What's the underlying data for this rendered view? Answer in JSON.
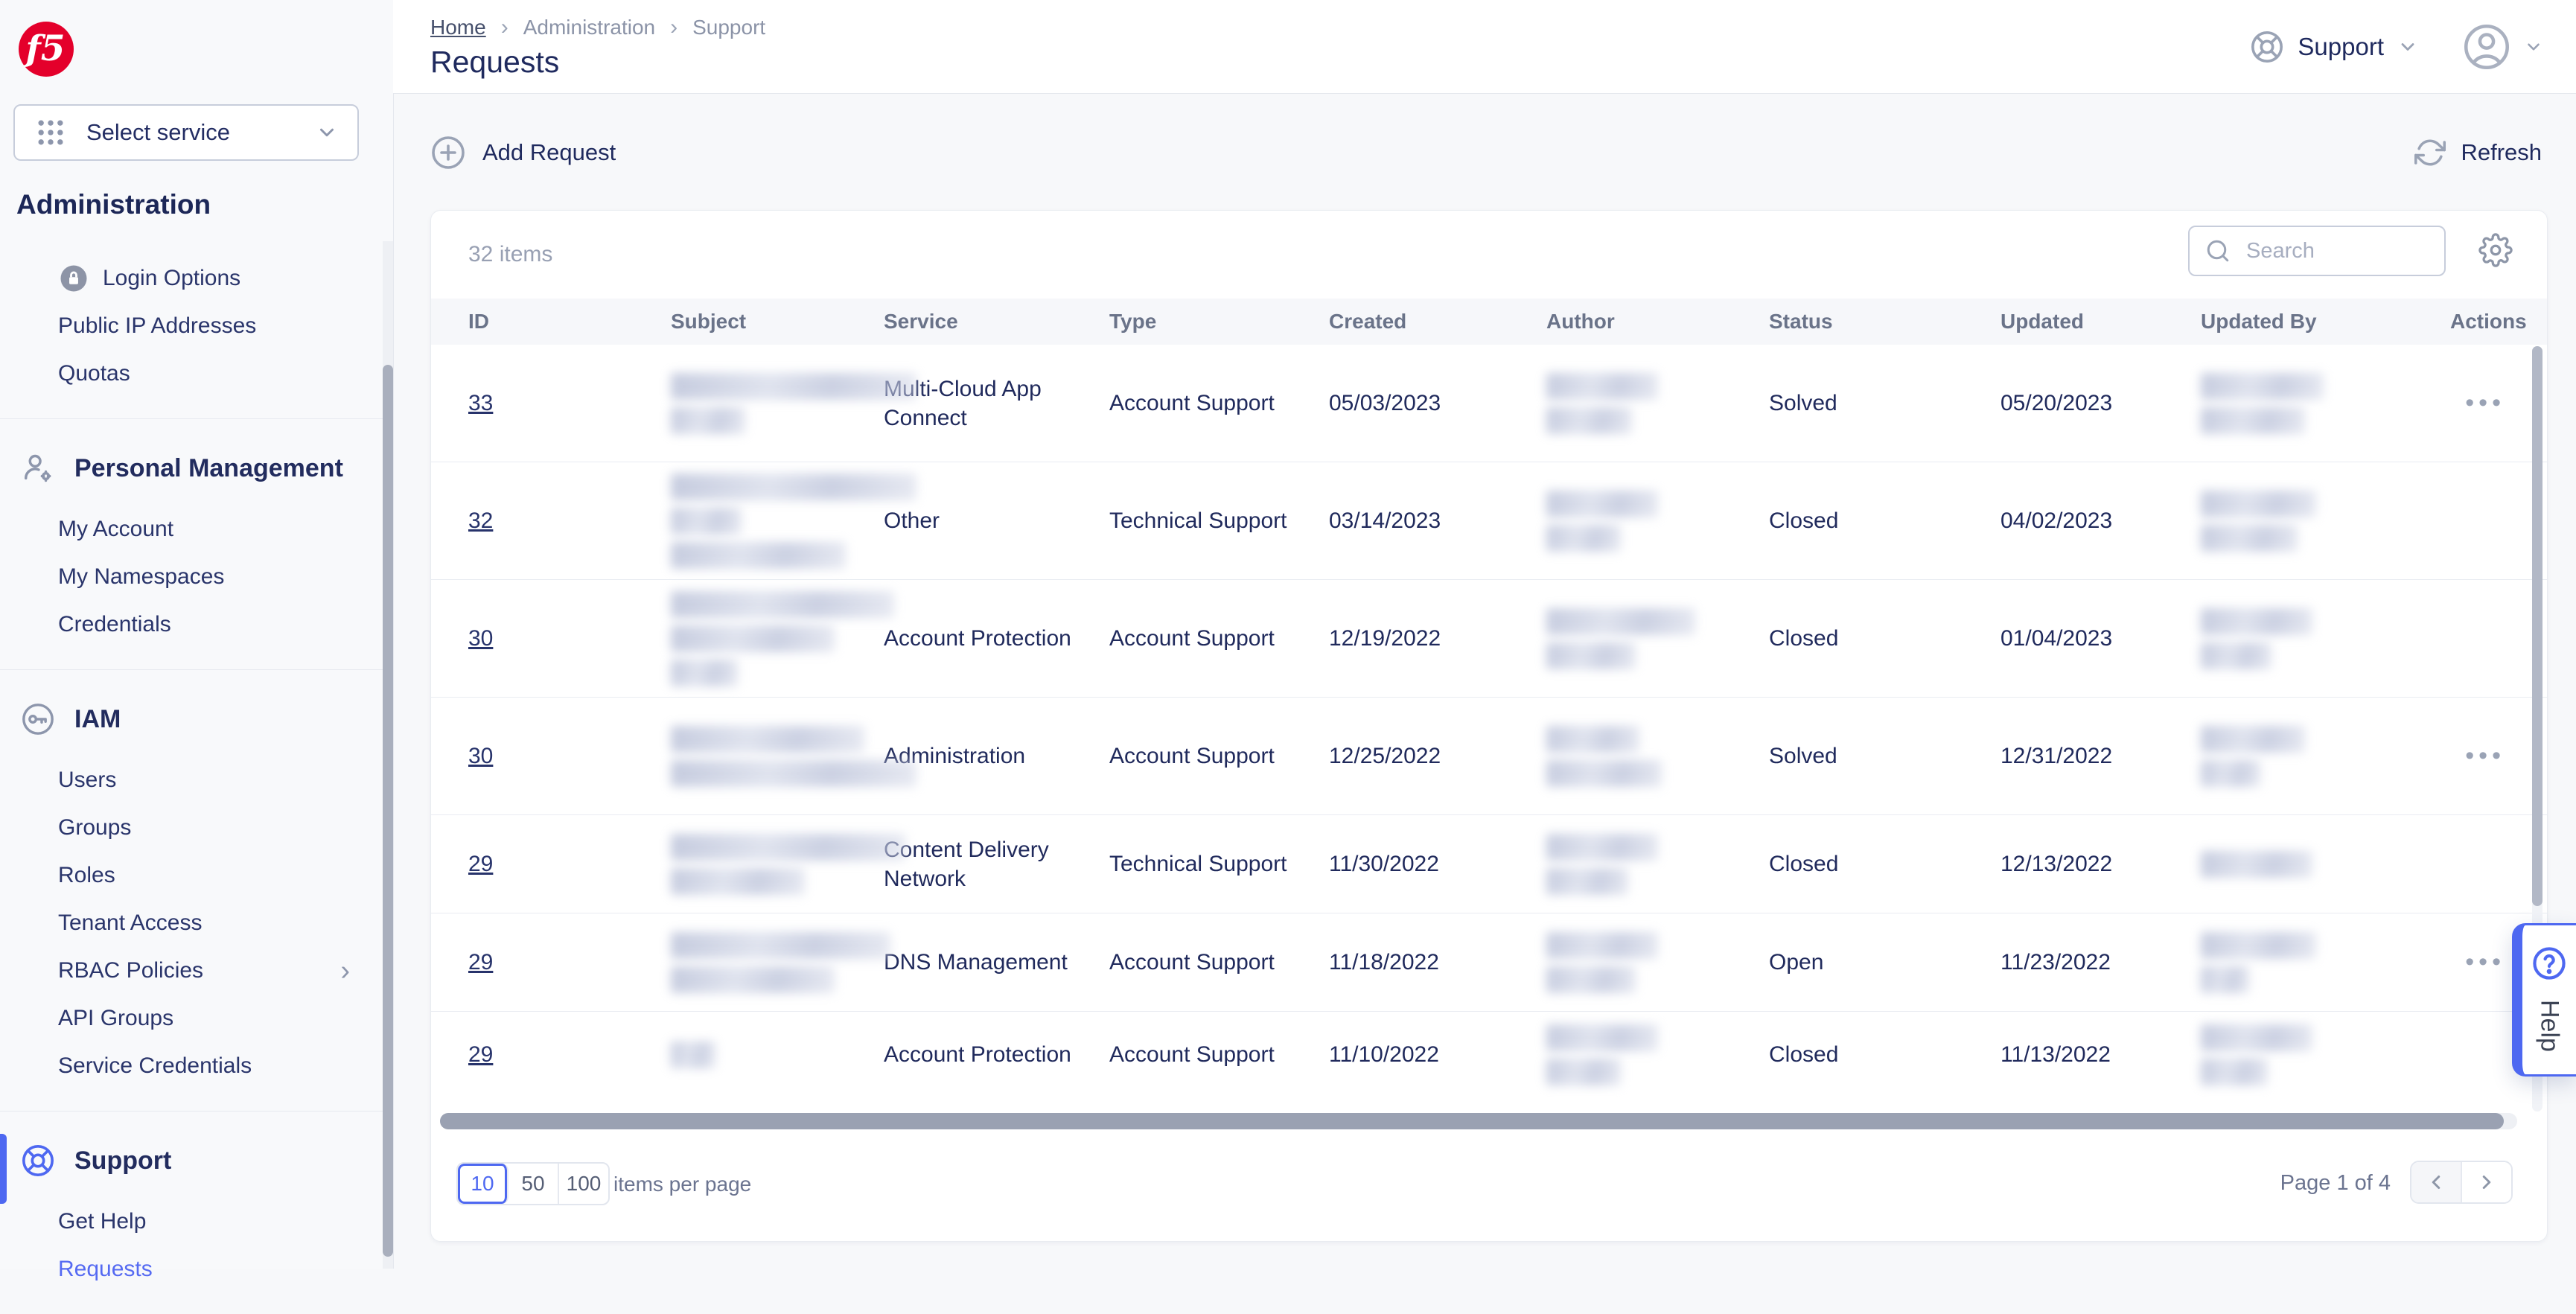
{
  "colors": {
    "accent": "#4e68f1",
    "brand_red": "#e4002b",
    "navy": "#1f2a5e"
  },
  "brand": {
    "logo_text": "f5"
  },
  "sidebar": {
    "select_service": "Select service",
    "title": "Administration",
    "chevron_right": "›",
    "sections": [
      {
        "items": [
          "Login Options",
          "Public IP Addresses",
          "Quotas"
        ]
      },
      {
        "heading": "Personal Management",
        "items": [
          "My Account",
          "My Namespaces",
          "Credentials"
        ]
      },
      {
        "heading": "IAM",
        "items": [
          "Users",
          "Groups",
          "Roles",
          "Tenant Access",
          "RBAC Policies",
          "API Groups",
          "Service Credentials"
        ]
      },
      {
        "heading": "Support",
        "items": [
          "Get Help",
          "Requests"
        ]
      }
    ]
  },
  "header": {
    "breadcrumb": [
      "Home",
      "Administration",
      "Support"
    ],
    "separator": "›",
    "title": "Requests",
    "support_menu_label": "Support"
  },
  "toolbar": {
    "add_request_label": "Add Request",
    "refresh_label": "Refresh"
  },
  "table": {
    "items_count": "32 items",
    "search_placeholder": "Search",
    "columns": [
      "ID",
      "Subject",
      "Service",
      "Type",
      "Created",
      "Author",
      "Status",
      "Updated",
      "Updated By",
      "Actions"
    ],
    "actions_glyph": "•••",
    "rows": [
      {
        "id_prefix": "33",
        "id_redact": 95,
        "subject_redact": [
          330,
          100
        ],
        "service": "Multi-Cloud App Connect",
        "type": "Account Support",
        "created": "05/03/2023",
        "author_redact": [
          150,
          115
        ],
        "status": "Solved",
        "updated": "05/20/2023",
        "updated_by_redact": [
          165,
          140
        ],
        "has_actions": true
      },
      {
        "id_prefix": "32",
        "id_redact": 95,
        "subject_redact": [
          330,
          95,
          235
        ],
        "service": "Other",
        "type": "Technical Support",
        "created": "03/14/2023",
        "author_redact": [
          150,
          100
        ],
        "status": "Closed",
        "updated": "04/02/2023",
        "updated_by_redact": [
          155,
          130
        ],
        "has_actions": false
      },
      {
        "id_prefix": "30",
        "id_redact": 95,
        "subject_redact": [
          300,
          220,
          90
        ],
        "service": "Account Protection",
        "type": "Account Support",
        "created": "12/19/2022",
        "author_redact": [
          200,
          120
        ],
        "status": "Closed",
        "updated": "01/04/2023",
        "updated_by_redact": [
          150,
          95
        ],
        "has_actions": false
      },
      {
        "id_prefix": "30",
        "id_redact": 95,
        "subject_redact": [
          260,
          330
        ],
        "service": "Administration",
        "type": "Account Support",
        "created": "12/25/2022",
        "author_redact": [
          125,
          155
        ],
        "status": "Solved",
        "updated": "12/31/2022",
        "updated_by_redact": [
          140,
          80
        ],
        "has_actions": true
      },
      {
        "id_prefix": "29",
        "id_redact": 95,
        "subject_redact": [
          315,
          180
        ],
        "service": "Content Delivery Network",
        "type": "Technical Support",
        "created": "11/30/2022",
        "author_redact": [
          150,
          110
        ],
        "status": "Closed",
        "updated": "12/13/2022",
        "updated_by_redact": [
          150
        ],
        "has_actions": false
      },
      {
        "id_prefix": "29",
        "id_redact": 95,
        "subject_redact": [
          295,
          220
        ],
        "service": "DNS Management",
        "type": "Account Support",
        "created": "11/18/2022",
        "author_redact": [
          150,
          120
        ],
        "status": "Open",
        "updated": "11/23/2022",
        "updated_by_redact": [
          155,
          65
        ],
        "has_actions": true
      },
      {
        "id_prefix": "29",
        "id_redact": 95,
        "subject_redact": [
          60
        ],
        "service": "Account Protection",
        "type": "Account Support",
        "created": "11/10/2022",
        "author_redact": [
          150,
          100
        ],
        "status": "Closed",
        "updated": "11/13/2022",
        "updated_by_redact": [
          150,
          90
        ],
        "has_actions": false
      }
    ]
  },
  "footer": {
    "page_sizes": [
      "10",
      "50",
      "100"
    ],
    "active_size": "10",
    "per_page_label": "items per page",
    "page_indicator": "Page 1 of 4"
  },
  "help": {
    "label": "Help"
  }
}
